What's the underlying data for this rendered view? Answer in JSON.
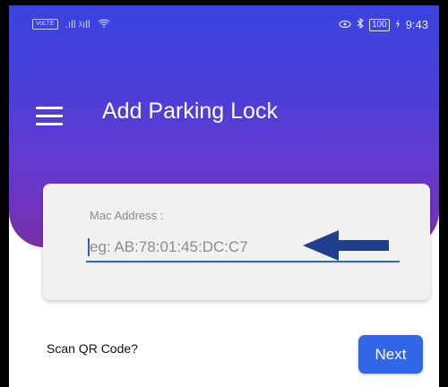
{
  "status_bar": {
    "left_badge": "VoLTE",
    "left_signal": ".ıll ᵡıll",
    "wifi": "WiFi",
    "battery": "100",
    "time": "9:43"
  },
  "header": {
    "title": "Add Parking Lock"
  },
  "form": {
    "label": "Mac Address :",
    "placeholder": "eg: AB:78:01:45:DC:C7",
    "value": ""
  },
  "scan_qr_label": "Scan QR Code?",
  "next_label": "Next",
  "colors": {
    "gradient_top": "#3a43e0",
    "gradient_bottom": "#7a2ea8",
    "accent": "#2f67e8",
    "annotation_arrow": "#1f3f8f"
  },
  "icons": {
    "menu": "hamburger-icon",
    "arrow": "left-arrow-annotation"
  }
}
